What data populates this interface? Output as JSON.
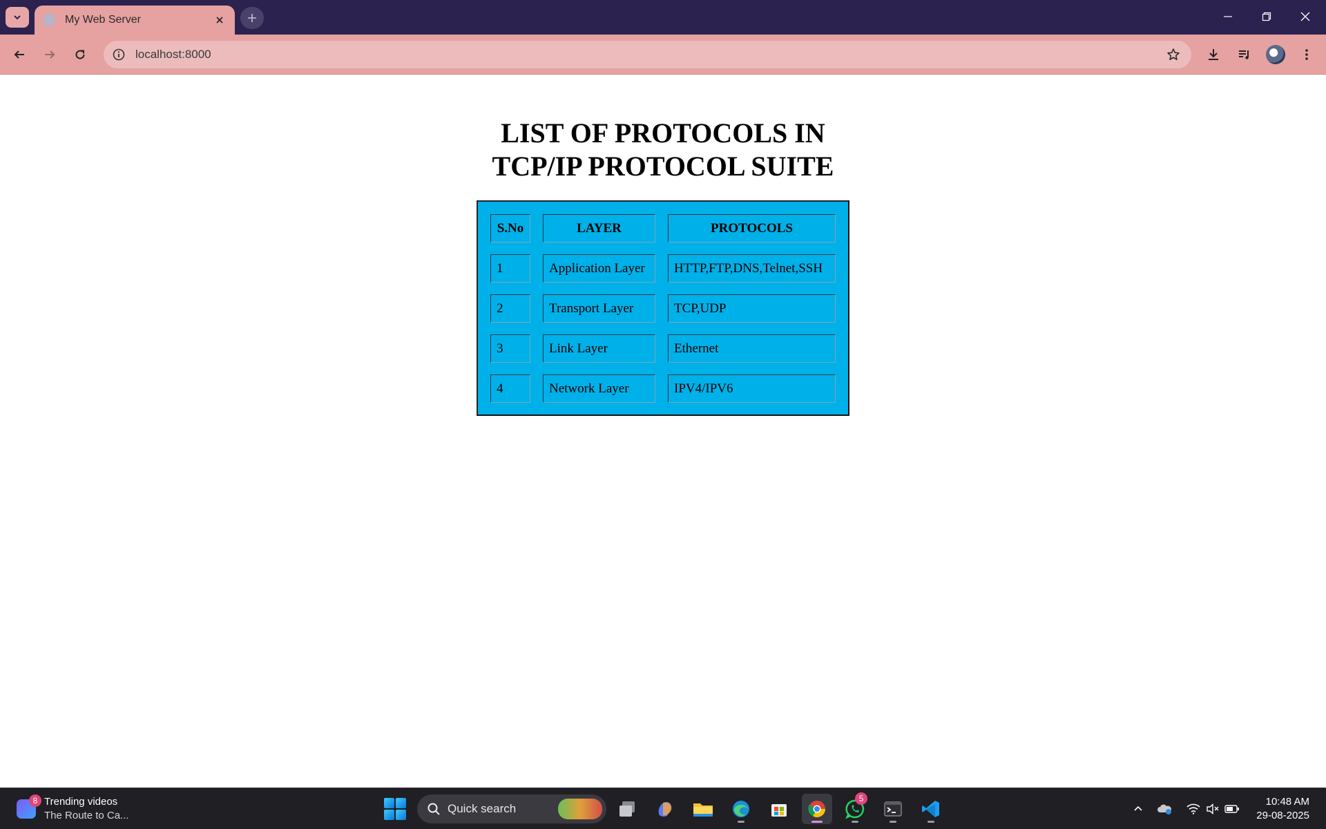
{
  "browser": {
    "tab_title": "My Web Server",
    "url": "localhost:8000"
  },
  "page": {
    "title_line1": "LIST OF PROTOCOLS IN",
    "title_line2": "TCP/IP PROTOCOL SUITE",
    "table": {
      "headers": [
        "S.No",
        "LAYER",
        "PROTOCOLS"
      ],
      "rows": [
        [
          "1",
          "Application Layer",
          "HTTP,FTP,DNS,Telnet,SSH"
        ],
        [
          "2",
          "Transport Layer",
          "TCP,UDP"
        ],
        [
          "3",
          "Link Layer",
          "Ethernet"
        ],
        [
          "4",
          "Network Layer",
          "IPV4/IPV6"
        ]
      ],
      "background_color": "#00b0e8"
    }
  },
  "taskbar": {
    "widget": {
      "badge": "8",
      "line1": "Trending videos",
      "line2": "The Route to Ca..."
    },
    "search_placeholder": "Quick search",
    "whatsapp_badge": "5",
    "apps": [
      "file-manager",
      "copilot",
      "file-explorer",
      "edge",
      "microsoft-store",
      "chrome",
      "whatsapp",
      "terminal",
      "vscode"
    ],
    "clock": {
      "time": "10:48 AM",
      "date": "29-08-2025"
    }
  },
  "colors": {
    "titlebar": "#2b2250",
    "toolbar": "#e6a1a1",
    "omnibox": "#ecbcbc",
    "taskbar": "#1f1f24"
  }
}
